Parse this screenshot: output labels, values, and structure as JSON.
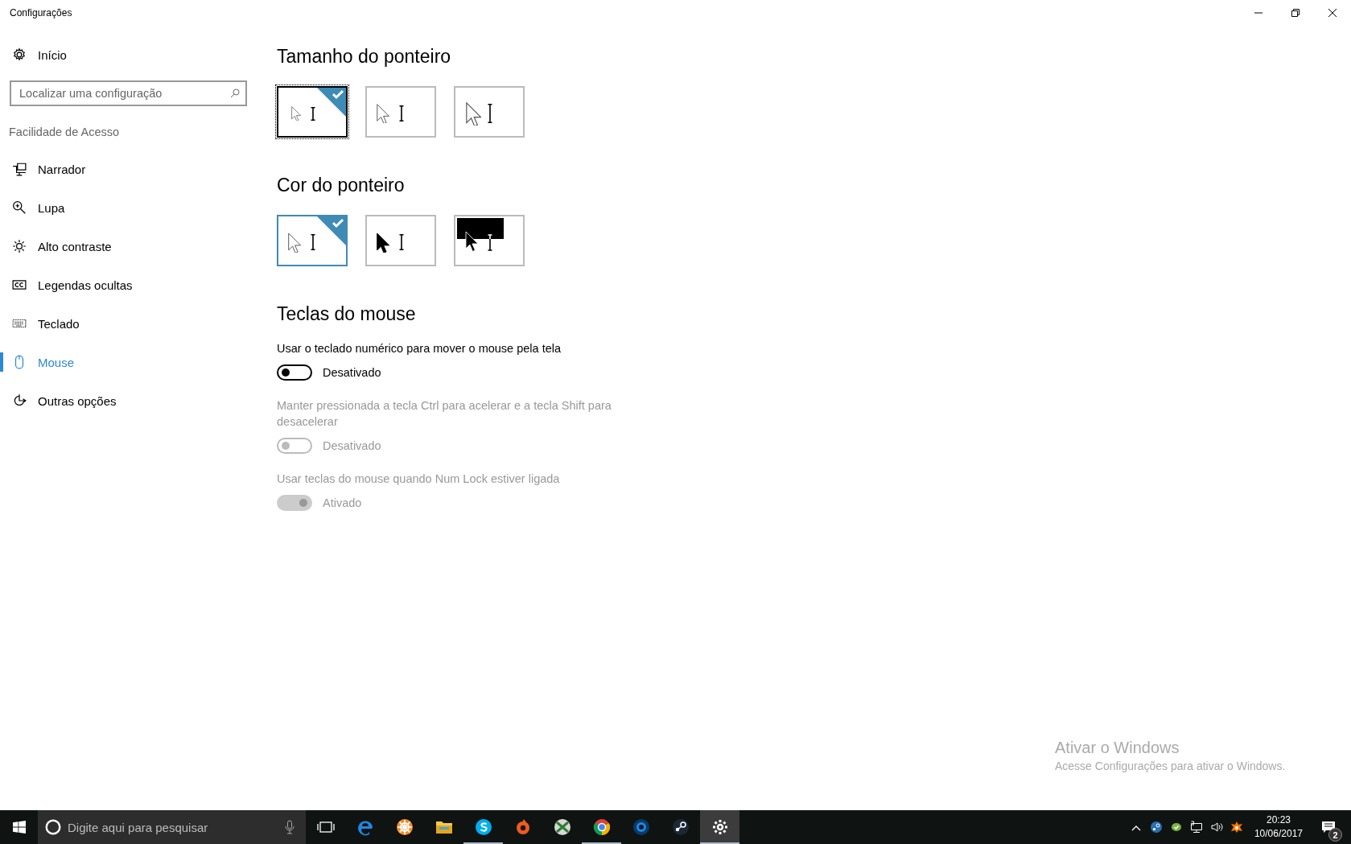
{
  "window": {
    "title": "Configurações"
  },
  "sidebar": {
    "home": {
      "label": "Início"
    },
    "search": {
      "placeholder": "Localizar uma configuração"
    },
    "section": "Facilidade de Acesso",
    "items": [
      {
        "label": "Narrador",
        "selected": false
      },
      {
        "label": "Lupa",
        "selected": false
      },
      {
        "label": "Alto contraste",
        "selected": false
      },
      {
        "label": "Legendas ocultas",
        "selected": false
      },
      {
        "label": "Teclado",
        "selected": false
      },
      {
        "label": "Mouse",
        "selected": true
      },
      {
        "label": "Outras opções",
        "selected": false
      }
    ]
  },
  "pointer_size": {
    "title": "Tamanho do ponteiro",
    "options": [
      {
        "kind": "small",
        "selected": true,
        "focused": true
      },
      {
        "kind": "medium",
        "selected": false,
        "focused": false
      },
      {
        "kind": "large",
        "selected": false,
        "focused": false
      }
    ]
  },
  "pointer_color": {
    "title": "Cor do ponteiro",
    "options": [
      {
        "kind": "white",
        "selected": true
      },
      {
        "kind": "black",
        "selected": false
      },
      {
        "kind": "inverted",
        "selected": false
      }
    ]
  },
  "mouse_keys": {
    "title": "Teclas do mouse",
    "settings": [
      {
        "label": "Usar o teclado numérico para mover o mouse pela tela",
        "state_text": "Desativado",
        "on": false,
        "disabled": false
      },
      {
        "label": "Manter pressionada a tecla Ctrl para acelerar e a tecla Shift para desacelerar",
        "state_text": "Desativado",
        "on": false,
        "disabled": true
      },
      {
        "label": "Usar teclas do mouse quando Num Lock estiver ligada",
        "state_text": "Ativado",
        "on": true,
        "disabled": true
      }
    ]
  },
  "activation_notice": {
    "title": "Ativar o Windows",
    "text": "Acesse Configurações para ativar o Windows."
  },
  "taskbar": {
    "search": {
      "placeholder": "Digite aqui para pesquisar"
    },
    "apps": [
      {
        "kind": "taskview",
        "running": false,
        "active": false
      },
      {
        "kind": "edge",
        "running": false,
        "active": false
      },
      {
        "kind": "wheel",
        "running": false,
        "active": false
      },
      {
        "kind": "folder",
        "running": false,
        "active": false
      },
      {
        "kind": "skype",
        "running": true,
        "active": false
      },
      {
        "kind": "origin",
        "running": false,
        "active": false
      },
      {
        "kind": "xbox",
        "running": false,
        "active": false
      },
      {
        "kind": "chrome",
        "running": true,
        "active": false
      },
      {
        "kind": "camera",
        "running": false,
        "active": false
      },
      {
        "kind": "steam",
        "running": false,
        "active": false
      },
      {
        "kind": "settings",
        "running": true,
        "active": true
      }
    ],
    "tray": [
      {
        "kind": "chevron"
      },
      {
        "kind": "steam"
      },
      {
        "kind": "check"
      },
      {
        "kind": "network"
      },
      {
        "kind": "volume"
      },
      {
        "kind": "avast"
      }
    ],
    "time": "20:23",
    "date": "10/06/2017",
    "notifications": "2"
  }
}
